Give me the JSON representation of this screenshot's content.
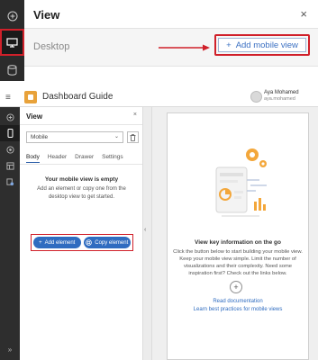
{
  "zoom_panel": {
    "title": "View",
    "close_glyph": "×",
    "row_label": "Desktop",
    "add_button_label": "Add mobile view",
    "add_button_glyph": "+",
    "rail_icons": [
      "plus-circle-icon",
      "desktop-icon",
      "database-icon"
    ],
    "highlight_color": "#d0202a"
  },
  "app": {
    "title": "Dashboard Guide",
    "user_name": "Aya Mohamed",
    "user_id": "aya.mohamed",
    "rail_icons": [
      "plus-circle-icon",
      "mobile-icon",
      "theme-icon",
      "layout-icon",
      "data-icon"
    ]
  },
  "view_panel": {
    "title": "View",
    "close_glyph": "×",
    "select_value": "Mobile",
    "tabs": [
      "Body",
      "Header",
      "Drawer",
      "Settings"
    ],
    "active_tab": "Body",
    "empty_title": "Your mobile view is empty",
    "empty_desc": "Add an element or copy one from the desktop view to get started.",
    "add_element_label": "Add element",
    "copy_element_label": "Copy element",
    "accent_color": "#2f6cc0"
  },
  "preview": {
    "title": "View key information on the go",
    "description": "Click the button below to start building your mobile view. Keep your mobile view simple. Limit the number of visualizations and their complexity. Need some inspiration first? Check out the links below.",
    "plus_glyph": "+",
    "link_docs": "Read documentation",
    "link_practices": "Learn best practices for mobile views"
  }
}
